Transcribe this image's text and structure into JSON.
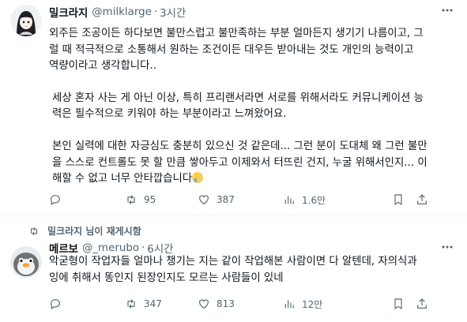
{
  "tweets": [
    {
      "name": "밀크라지",
      "handle": "@milklarge",
      "dot": "·",
      "time": "3시간",
      "paragraphs": [
        "외주든 조공이든 하다보면 불만스럽고 불만족하는 부분 얼마든지 생기기 나름이고, 그\n럴 때 적극적으로 소통해서 원하는 조건이든 대우든 받아내는 것도 개인의 능력이고\n역량이라고 생각합니다..",
        "세상 혼자 사는 게 아닌 이상, 특히 프리랜서라면 서로를 위해서라도 커뮤니케이션 능\n력은 필수적으로 키워야 하는 부분이라고 느껴왔어요.",
        "본인 실력에 대한 자긍심도 충분히 있으신 것 같은데... 그런 분이 도대체 왜 그런 불만\n을 스스로 컨트롤도 못 할 만큼 쌓아두고 이제와서 터뜨린 건지, 누굴 위해서인지... 이\n해할 수 없고 너무 안타깝습니다"
      ],
      "emoji": "crying-face-emoji",
      "stats": {
        "replies": "",
        "retweets": "95",
        "likes": "387",
        "views": "1.6만"
      }
    },
    {
      "social_context": "밀크라지 님이 재게시함",
      "name": "메르보",
      "handle": "@_merubo",
      "dot": "·",
      "time": "6시간",
      "paragraphs": [
        "악굳형이 작업자들 얼마나 챙기는 지는 같이 작업해본 사람이면 다 알텐데, 자의식과\n잉에 취해서 똥인지 된장인지도 모르는 사람들이 있네"
      ],
      "stats": {
        "replies": "",
        "retweets": "347",
        "likes": "813",
        "views": "12만"
      }
    }
  ],
  "icons": {
    "more": "more-horizontal-icon",
    "reply": "reply-icon",
    "retweet": "retweet-icon",
    "like": "heart-icon",
    "views": "views-icon",
    "bookmark": "bookmark-icon",
    "share": "share-icon"
  },
  "colors": {
    "text": "#0f1419",
    "secondary": "#536471",
    "divider": "#eff3f4"
  }
}
